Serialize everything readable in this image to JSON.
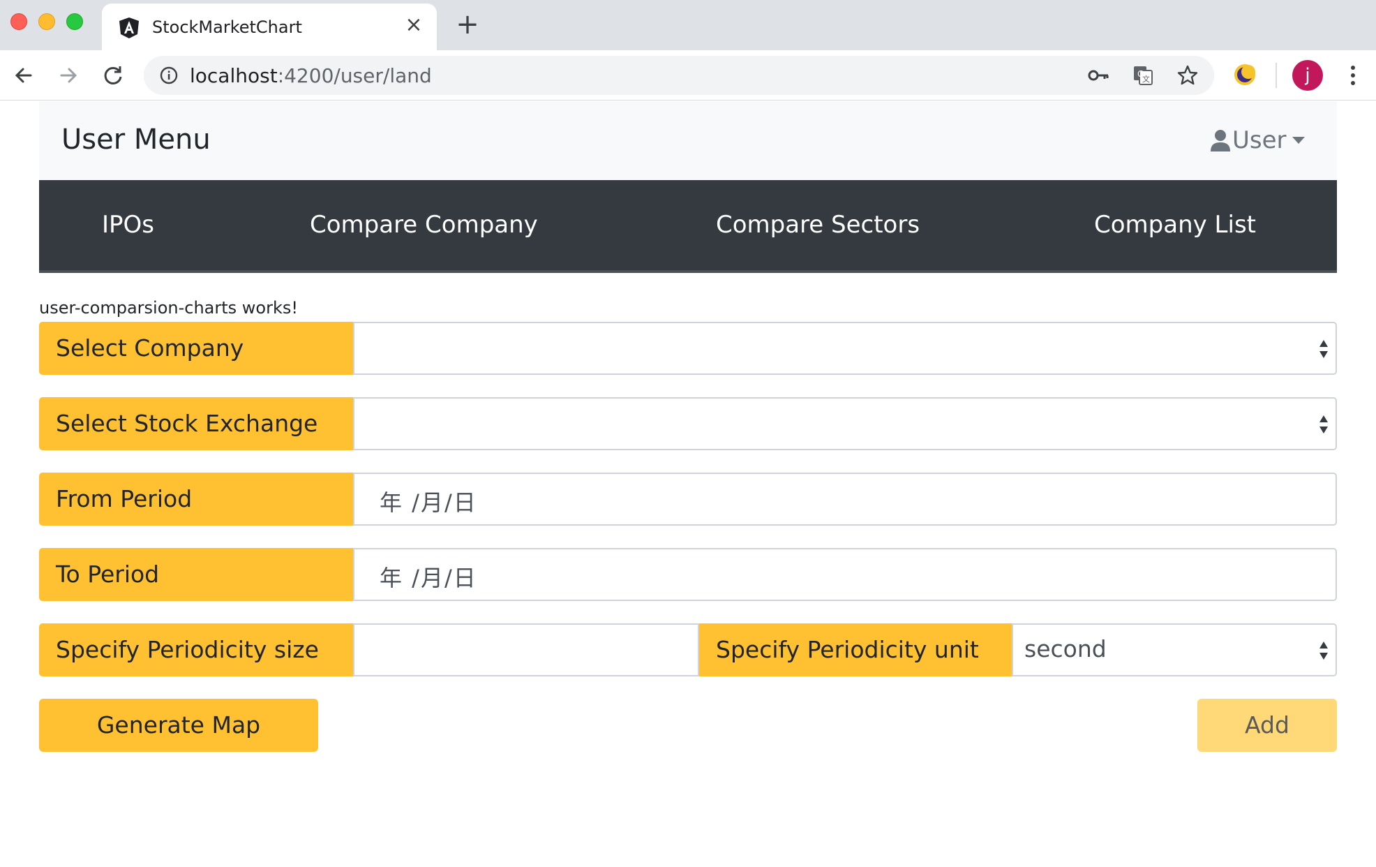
{
  "browser": {
    "tab_title": "StockMarketChart",
    "url_host": "localhost",
    "url_path": ":4200/user/land",
    "avatar_letter": "j"
  },
  "header": {
    "brand": "User Menu",
    "user_menu_label": "User"
  },
  "nav": {
    "items": [
      {
        "label": "IPOs"
      },
      {
        "label": "Compare Company"
      },
      {
        "label": "Compare Sectors"
      },
      {
        "label": "Company List"
      }
    ]
  },
  "main": {
    "works_text": "user-comparsion-charts works!",
    "select_company_label": "Select Company",
    "select_company_value": "",
    "select_exchange_label": "Select Stock Exchange",
    "select_exchange_value": "",
    "from_period_label": "From Period",
    "from_period_placeholder": "年 /月/日",
    "to_period_label": "To Period",
    "to_period_placeholder": "年 /月/日",
    "periodicity_size_label": "Specify Periodicity size",
    "periodicity_size_value": "",
    "periodicity_unit_label": "Specify Periodicity unit",
    "periodicity_unit_value": "second",
    "generate_button": "Generate Map",
    "add_button": "Add"
  },
  "colors": {
    "accent": "#ffc132",
    "navbar_dark": "#343a40",
    "navbar_light": "#f8f9fa",
    "add_button_disabled": "#ffd877"
  }
}
